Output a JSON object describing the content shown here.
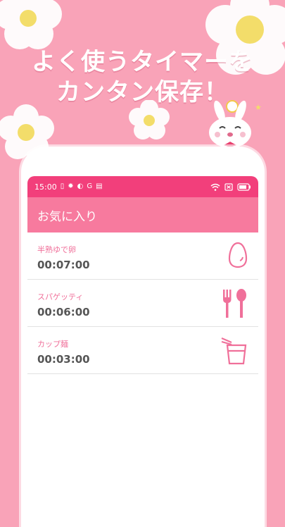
{
  "headline": {
    "line1": "よく使うタイマーを",
    "line2": "カンタン保存！"
  },
  "status_bar": {
    "time": "15:00",
    "letter": "G"
  },
  "app_bar": {
    "title": "お気に入り"
  },
  "favorites": [
    {
      "name": "半熟ゆで卵",
      "time": "00:07:00",
      "icon": "egg-icon"
    },
    {
      "name": "スパゲッティ",
      "time": "00:06:00",
      "icon": "fork-spoon-icon"
    },
    {
      "name": "カップ麺",
      "time": "00:03:00",
      "icon": "cup-noodle-icon"
    }
  ],
  "colors": {
    "background": "#f9a3b8",
    "status_bar": "#f23f7b",
    "app_bar": "#f77a9e",
    "accent": "#f0709a"
  }
}
